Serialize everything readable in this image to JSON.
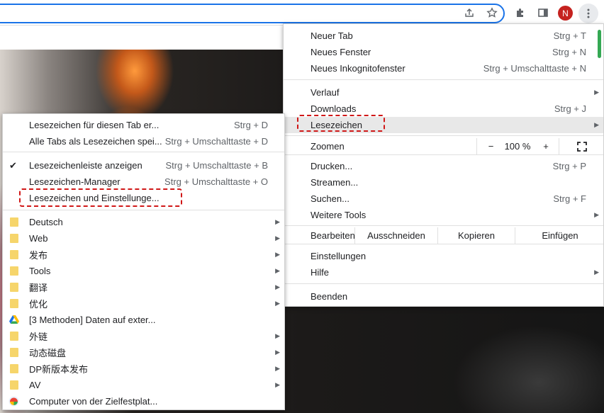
{
  "toolbar": {
    "share_icon": "share-icon",
    "star_icon": "star-icon",
    "extensions_icon": "puzzle-icon",
    "sidepanel_icon": "side-panel-icon",
    "avatar_letter": "N",
    "menu_icon": "kebab-icon"
  },
  "main_menu": {
    "items": [
      {
        "label": "Neuer Tab",
        "shortcut": "Strg + T"
      },
      {
        "label": "Neues Fenster",
        "shortcut": "Strg + N"
      },
      {
        "label": "Neues Inkognitofenster",
        "shortcut": "Strg + Umschalttaste + N"
      },
      {
        "label": "Verlauf",
        "shortcut": ""
      },
      {
        "label": "Downloads",
        "shortcut": "Strg + J"
      },
      {
        "label": "Lesezeichen",
        "shortcut": ""
      },
      {
        "label": "Zoomen",
        "shortcut": ""
      },
      {
        "label": "Drucken...",
        "shortcut": "Strg + P"
      },
      {
        "label": "Streamen...",
        "shortcut": ""
      },
      {
        "label": "Suchen...",
        "shortcut": "Strg + F"
      },
      {
        "label": "Weitere Tools",
        "shortcut": ""
      },
      {
        "label": "Einstellungen",
        "shortcut": ""
      },
      {
        "label": "Hilfe",
        "shortcut": ""
      },
      {
        "label": "Beenden",
        "shortcut": ""
      }
    ],
    "zoom": {
      "minus": "−",
      "value": "100 %",
      "plus": "+"
    },
    "edit": {
      "label": "Bearbeiten",
      "cut": "Ausschneiden",
      "copy": "Kopieren",
      "paste": "Einfügen"
    }
  },
  "bookmarks_menu": {
    "items": [
      {
        "label": "Lesezeichen für diesen Tab er...",
        "shortcut": "Strg + D"
      },
      {
        "label": "Alle Tabs als Lesezeichen spei...",
        "shortcut": "Strg + Umschalttaste + D"
      },
      {
        "label": "Lesezeichenleiste anzeigen",
        "shortcut": "Strg + Umschalttaste + B"
      },
      {
        "label": "Lesezeichen-Manager",
        "shortcut": "Strg + Umschalttaste + O"
      },
      {
        "label": "Lesezeichen und Einstellunge...",
        "shortcut": ""
      }
    ],
    "folders": [
      "Deutsch",
      "Web",
      "发布",
      "Tools",
      "翻译",
      "优化",
      "[3 Methoden] Daten auf exter...",
      "外链",
      "动态磁盘",
      "DP新版本发布",
      "AV",
      "Computer von der Zielfestplat..."
    ]
  },
  "colors": {
    "highlight_box": "#d01818",
    "omnibox_border": "#1a73e8",
    "avatar_bg": "#c5221f",
    "folder": "#f6d56b"
  }
}
